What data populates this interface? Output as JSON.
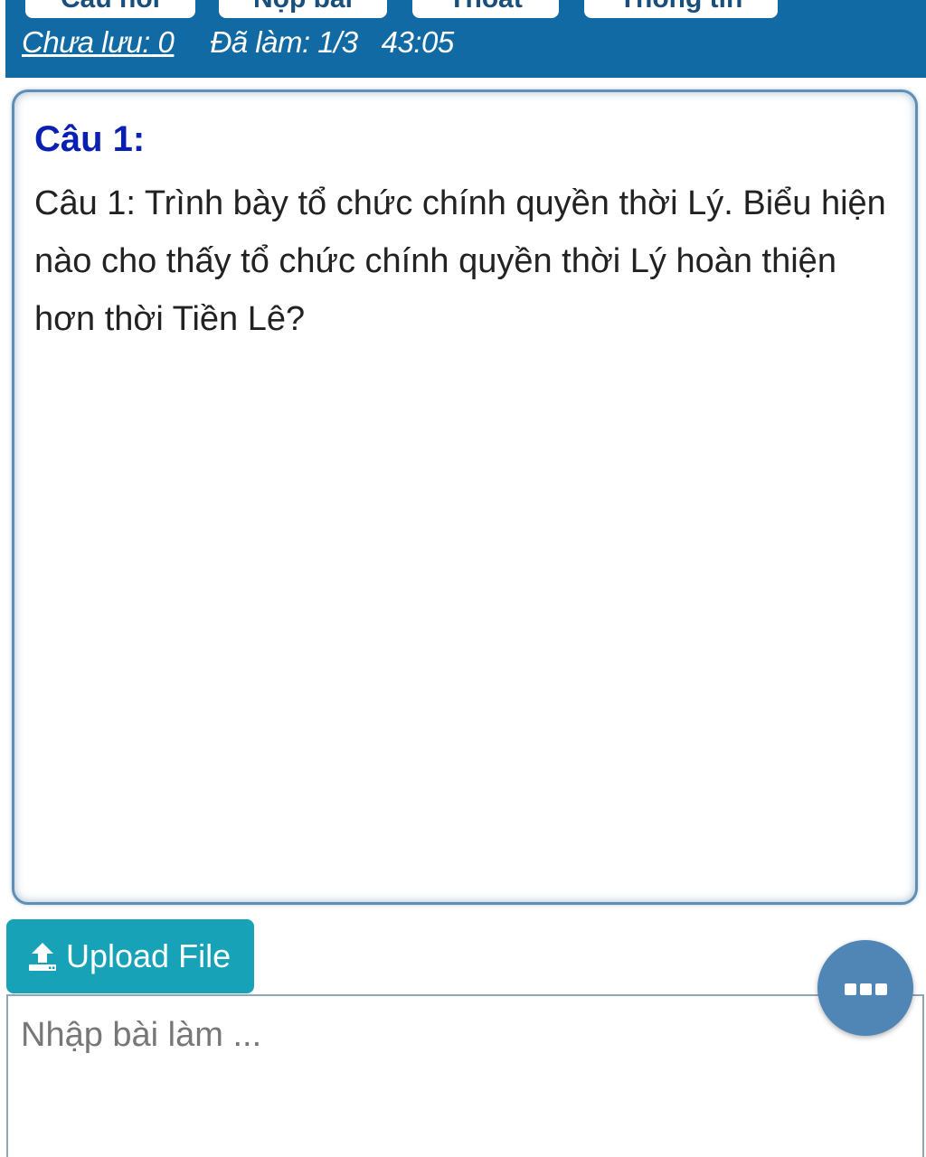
{
  "toolbar": {
    "buttons": [
      {
        "label": "Câu hỏi"
      },
      {
        "label": "Nộp bài"
      },
      {
        "label": "Thoát"
      },
      {
        "label": "Thông tin"
      }
    ]
  },
  "status": {
    "unsaved": "Chưa lưu: 0",
    "done": "Đã làm: 1/3",
    "timer": "43:05"
  },
  "question": {
    "title": "Câu 1:",
    "text": "Câu 1: Trình bày tổ chức chính quyền thời Lý. Biểu hiện nào cho thấy tổ chức chính quyền thời Lý hoàn thiện hơn thời Tiền Lê?"
  },
  "upload": {
    "label": "Upload File",
    "icon": "upload-icon"
  },
  "fab": {
    "icon": "more-dots-icon"
  },
  "answer": {
    "placeholder": "Nhập bài làm ..."
  },
  "colors": {
    "header": "#116aa3",
    "question_title": "#0b1fb3",
    "upload_button": "#18a2b8",
    "fab": "#4f86b6"
  }
}
